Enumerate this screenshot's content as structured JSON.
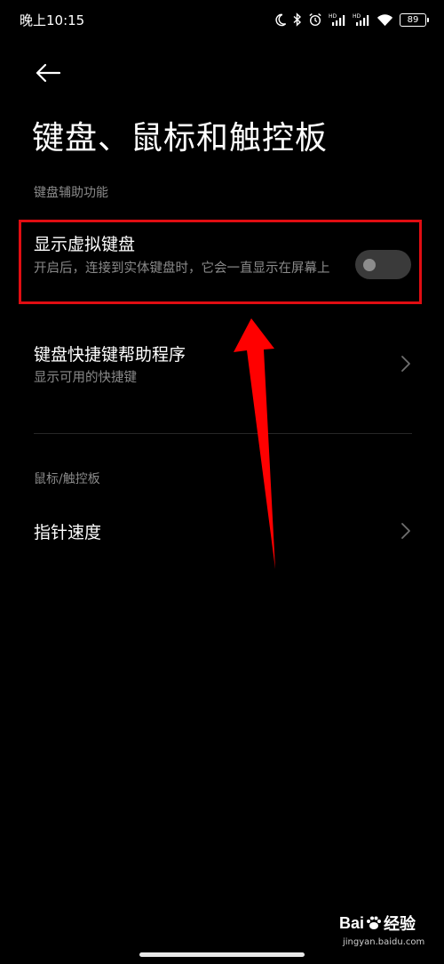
{
  "status_bar": {
    "time": "晚上10:15",
    "battery": "89",
    "icons": [
      "moon-icon",
      "bluetooth-icon",
      "alarm-icon",
      "hd-signal-icon",
      "hd-signal-icon",
      "wifi-icon",
      "battery-icon"
    ]
  },
  "header": {
    "back_icon": "back-arrow-icon",
    "title": "键盘、鼠标和触控板"
  },
  "sections": [
    {
      "header": "键盘辅助功能",
      "items": [
        {
          "title": "显示虚拟键盘",
          "subtitle": "开启后，连接到实体键盘时，它会一直显示在屏幕上",
          "control": "toggle",
          "toggle_on": false
        },
        {
          "title": "键盘快捷键帮助程序",
          "subtitle": "显示可用的快捷键",
          "control": "chevron"
        }
      ]
    },
    {
      "header": "鼠标/触控板",
      "items": [
        {
          "title": "指针速度",
          "control": "chevron"
        }
      ]
    }
  ],
  "annotation": {
    "highlight_color": "#e00d12",
    "arrow_color": "#ff0000"
  },
  "watermark": {
    "brand": "Bai",
    "brand_suffix": "经验",
    "url": "jingyan.baidu.com"
  },
  "colors": {
    "background": "#000000",
    "primary_text": "#ffffff",
    "secondary_text": "#8a8a8a",
    "toggle_track": "#3a3a3a"
  }
}
